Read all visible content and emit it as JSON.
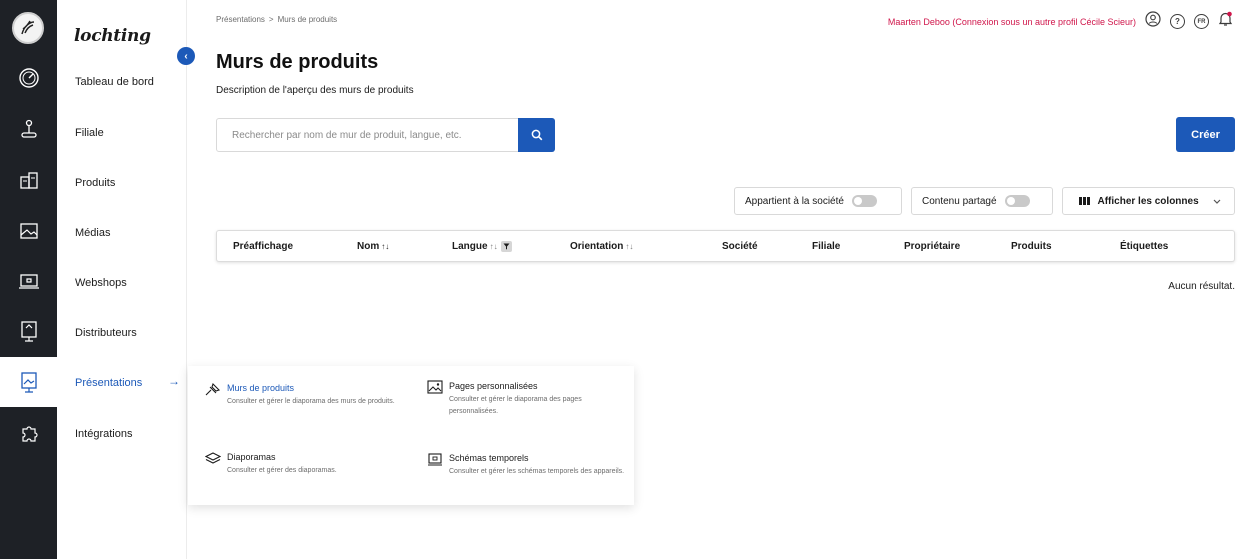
{
  "app": {
    "brand": "lochting"
  },
  "rail": {
    "icons": [
      "logo-icon",
      "dashboard-icon",
      "joystick-icon",
      "products-icon",
      "media-icon",
      "webshop-icon",
      "distributor-icon",
      "presentation-icon",
      "puzzle-icon"
    ]
  },
  "nav": {
    "items": [
      {
        "label": "Tableau de bord"
      },
      {
        "label": "Filiale"
      },
      {
        "label": "Produits"
      },
      {
        "label": "Médias"
      },
      {
        "label": "Webshops"
      },
      {
        "label": "Distributeurs"
      },
      {
        "label": "Présentations",
        "active": true
      },
      {
        "label": "Intégrations"
      }
    ],
    "arrow": "→",
    "collapse": "‹"
  },
  "breadcrumb": {
    "parent": "Présentations",
    "separator": ">",
    "current": "Murs de produits"
  },
  "header": {
    "user_link": "Maarten Deboo (Connexion sous un autre profil Cécile Scieur)",
    "help": "?",
    "lang": "FR"
  },
  "page": {
    "title": "Murs de produits",
    "description": "Description de l'aperçu des murs de produits"
  },
  "search": {
    "placeholder": "Rechercher par nom de mur de produit, langue, etc.",
    "value": ""
  },
  "create_label": "Créer",
  "filters": {
    "owned": "Appartient à la société",
    "shared": "Contenu partagé",
    "columns": "Afficher les colonnes"
  },
  "table": {
    "columns": [
      "Préaffichage",
      "Nom",
      "Langue",
      "Orientation",
      "Société",
      "Filiale",
      "Propriétaire",
      "Produits",
      "Étiquettes"
    ],
    "empty": "Aucun résultat."
  },
  "menu": {
    "items": [
      {
        "title": "Murs de produits",
        "desc": "Consulter et gérer le diaporama des murs de produits.",
        "icon": "pin-icon"
      },
      {
        "title": "Pages personnalisées",
        "desc": "Consulter et gérer le diaporama des pages personnalisées.",
        "icon": "image-icon"
      },
      {
        "title": "Diaporamas",
        "desc": "Consulter et gérer des diaporamas.",
        "icon": "layers-icon"
      },
      {
        "title": "Schémas temporels",
        "desc": "Consulter et gérer les schémas temporels des appareils.",
        "icon": "schedule-icon"
      }
    ]
  },
  "colors": {
    "accent": "#1c59b8",
    "rail": "#1e2126",
    "user_link": "#d0164b"
  }
}
